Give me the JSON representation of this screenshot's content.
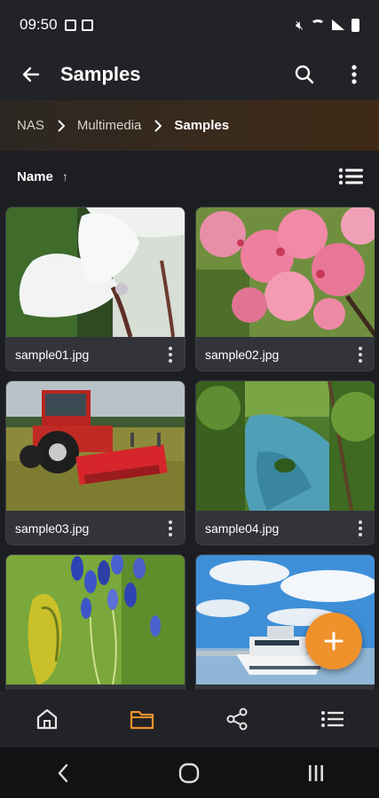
{
  "status_bar": {
    "time": "09:50"
  },
  "app_bar": {
    "title": "Samples"
  },
  "breadcrumb": {
    "items": [
      "NAS",
      "Multimedia",
      "Samples"
    ]
  },
  "sort": {
    "label": "Name",
    "direction": "ascending"
  },
  "files": [
    {
      "name": "sample01.jpg",
      "image": "white cyclamen flower"
    },
    {
      "name": "sample02.jpg",
      "image": "pink cherry blossoms"
    },
    {
      "name": "sample03.jpg",
      "image": "red tractor with tiller on field"
    },
    {
      "name": "sample04.jpg",
      "image": "pond in green park"
    },
    {
      "name": "",
      "image": "blue agapanthus flower"
    },
    {
      "name": "",
      "image": "motor yacht in harbor"
    }
  ],
  "colors": {
    "accent": "#f0922b",
    "background": "#1d1e22",
    "app_bar": "#222327",
    "card": "#2e3036"
  },
  "bottom_nav": {
    "items": [
      {
        "icon": "home-icon",
        "active": false
      },
      {
        "icon": "folder-icon",
        "active": true
      },
      {
        "icon": "share-icon",
        "active": false
      },
      {
        "icon": "list-icon",
        "active": false
      }
    ]
  },
  "system_nav": [
    "back-icon",
    "home-circle-icon",
    "recents-icon"
  ]
}
